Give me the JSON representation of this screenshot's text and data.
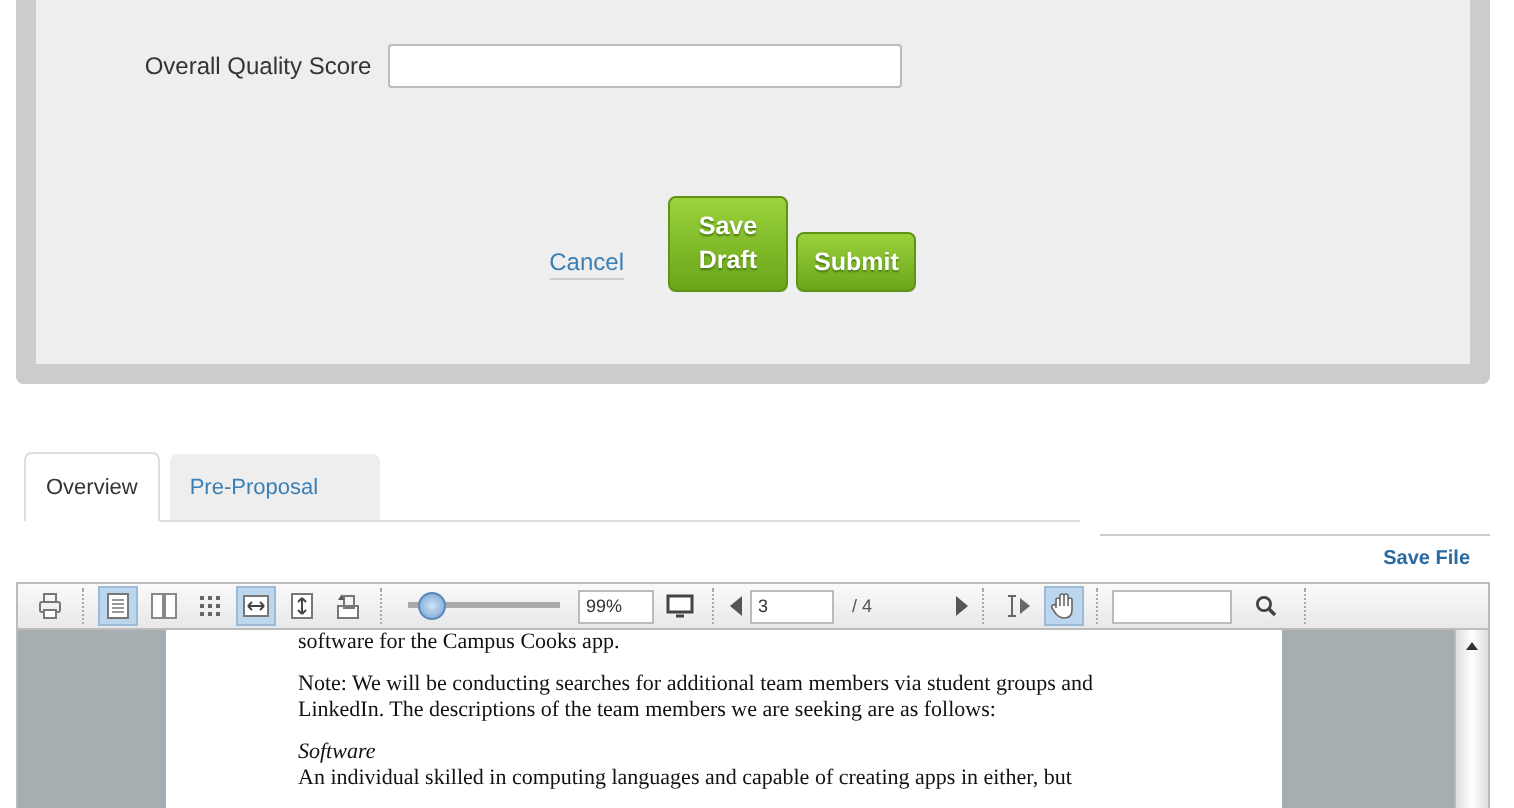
{
  "form": {
    "score_label": "Overall Quality Score",
    "actions": [
      {
        "kind": "link",
        "label": "Cancel"
      },
      {
        "kind": "button",
        "label": "Save Draft"
      },
      {
        "kind": "button",
        "label": "Submit"
      }
    ]
  },
  "tabs": [
    {
      "label": "Overview",
      "selected": true
    },
    {
      "label": "Pre-Proposal",
      "selected": false
    }
  ],
  "save_file": "Save File",
  "viewer": {
    "tools": [
      {
        "kind": "print",
        "selected": false
      },
      {
        "kind": "single-page",
        "selected": true
      },
      {
        "kind": "two-page",
        "selected": false
      },
      {
        "kind": "grid",
        "selected": false
      },
      {
        "kind": "fit-width",
        "selected": true
      },
      {
        "kind": "fit-height",
        "selected": false
      },
      {
        "kind": "rotate",
        "selected": false
      }
    ],
    "zoom": {
      "level": 0.08,
      "value": "99%"
    },
    "page": {
      "value": "3",
      "total": "/ 4"
    },
    "modes": [
      {
        "kind": "text-select",
        "selected": false
      },
      {
        "kind": "hand",
        "selected": true
      }
    ],
    "document": [
      {
        "kind": "text",
        "text": "software for the Campus Cooks app."
      },
      {
        "kind": "text",
        "text": "Note: We will be conducting searches for additional team members via student groups and LinkedIn. The descriptions of the team members we are seeking are as follows:"
      },
      {
        "kind": "heading",
        "text": "Software"
      },
      {
        "kind": "text",
        "text": "An individual skilled in computing languages and capable of creating apps in either, but"
      }
    ]
  }
}
